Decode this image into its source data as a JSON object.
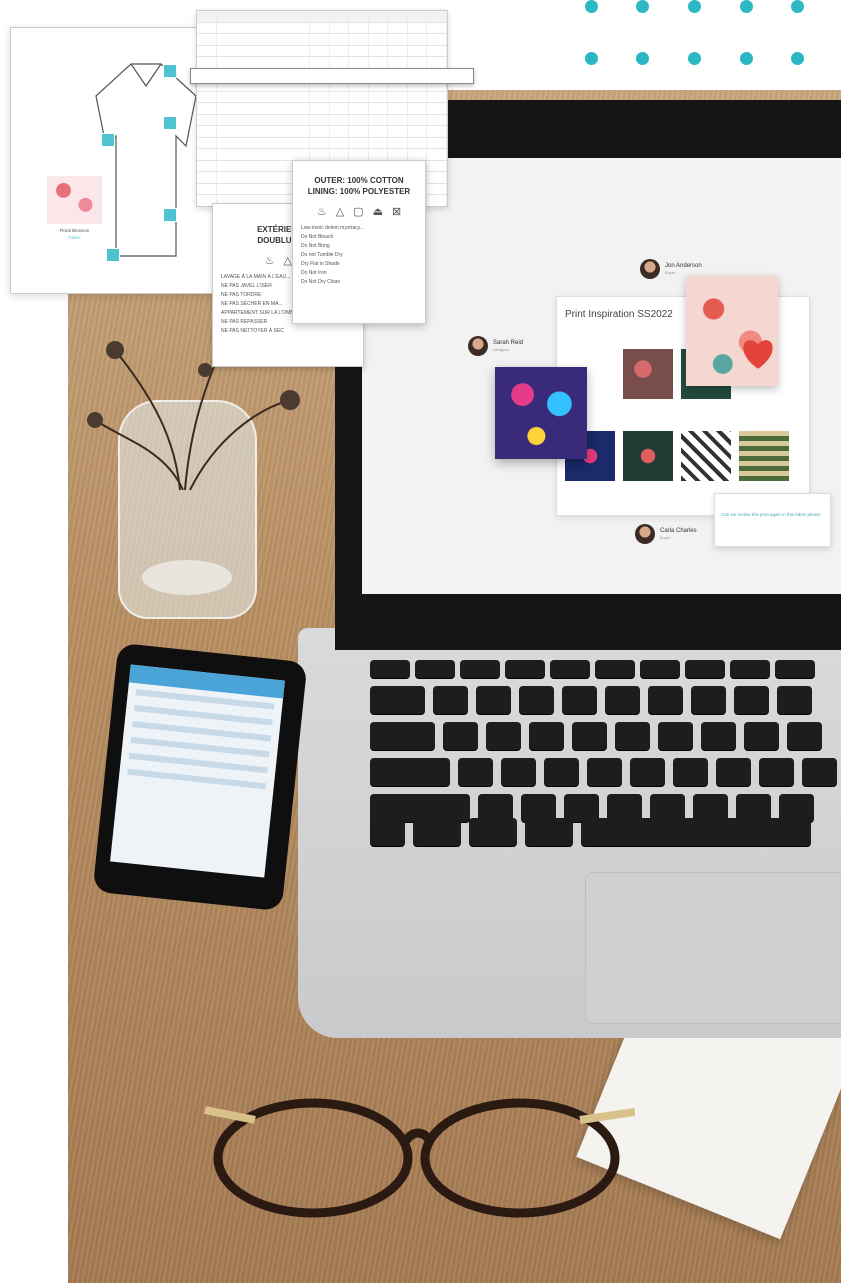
{
  "decoration": {
    "dot_color": "#2bb7c4",
    "dot_rows": 2,
    "dot_cols": 5
  },
  "care_label_en": {
    "title_line1": "OUTER: 100% COTTON",
    "title_line2": "LINING: 100% POLYESTER",
    "instructions": [
      "Low-ironic delem.mystracy...",
      "Do Not Bleach",
      "Do Not Bring",
      "Do not Tumble Dry",
      "Dry Flat in Shade",
      "Do Not Iron",
      "Do Not Dry Clean"
    ]
  },
  "care_label_fr": {
    "title_line1": "EXTÉRIEUR : 10",
    "title_line2": "DOUBLURE : 10",
    "instructions": [
      "LAVAGE À LA MAIN À L'EAU...",
      "NE PAS JAVEL L'ISER",
      "NE PAS TORDRE",
      "NE PAS SÉCHER EN MA...",
      "APPARTEMENT SUR LA L'OMBRE",
      "NE PAS REPASSER",
      "NE PAS NETTOYER À SEC"
    ]
  },
  "shirt_card": {
    "swatch_caption": "Floral Blossom",
    "swatch_sub": "Fabric"
  },
  "screen": {
    "people": [
      {
        "name": "Jon Anderson",
        "role": "Buyer"
      },
      {
        "name": "Sarah Reid",
        "role": "Designer"
      },
      {
        "name": "Carla Charles",
        "role": "Buyer"
      }
    ],
    "board_title": "Print Inspiration SS2022",
    "comment_text": "Can we review this print again in this fabric please"
  }
}
